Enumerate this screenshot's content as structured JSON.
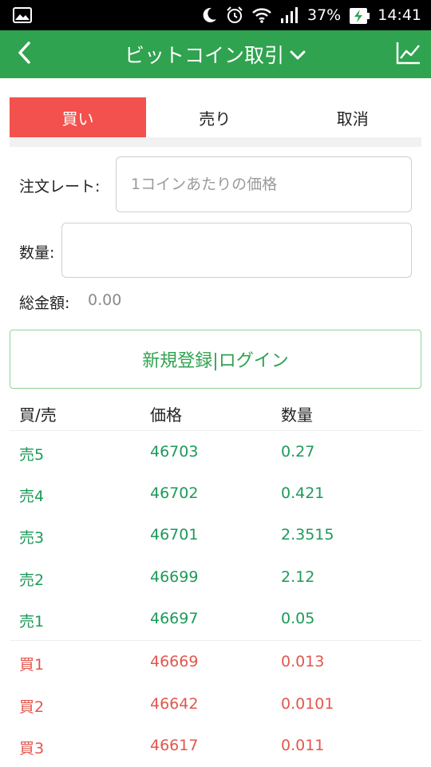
{
  "status_bar": {
    "battery": "37%",
    "time": "14:41",
    "icons": [
      "image-icon",
      "moon-icon",
      "alarm-icon",
      "wifi-icon",
      "signal-icon",
      "battery-charging-icon"
    ]
  },
  "app_bar": {
    "title": "ビットコイン取引",
    "back_icon": "chevron-left-icon",
    "dropdown_icon": "chevron-down-icon",
    "chart_icon": "line-chart-icon"
  },
  "tabs": [
    {
      "label": "買い",
      "active": true
    },
    {
      "label": "売り",
      "active": false
    },
    {
      "label": "取消",
      "active": false
    }
  ],
  "form": {
    "rate_label": "注文レート:",
    "rate_placeholder": "1コインあたりの価格",
    "qty_label": "数量:",
    "total_label": "総金額:",
    "total_value": "0.00"
  },
  "login_button": "新規登録|ログイン",
  "order_book": {
    "headers": [
      "買/売",
      "価格",
      "数量"
    ],
    "asks": [
      {
        "side": "売5",
        "price": "46703",
        "qty": "0.27"
      },
      {
        "side": "売4",
        "price": "46702",
        "qty": "0.421"
      },
      {
        "side": "売3",
        "price": "46701",
        "qty": "2.3515"
      },
      {
        "side": "売2",
        "price": "46699",
        "qty": "2.12"
      },
      {
        "side": "売1",
        "price": "46697",
        "qty": "0.05"
      }
    ],
    "bids": [
      {
        "side": "買1",
        "price": "46669",
        "qty": "0.013"
      },
      {
        "side": "買2",
        "price": "46642",
        "qty": "0.0101"
      },
      {
        "side": "買3",
        "price": "46617",
        "qty": "0.011"
      }
    ]
  },
  "colors": {
    "primary_green": "#2fa34f",
    "buy_red": "#f2514e",
    "ask_green": "#1d9a5a",
    "bid_red": "#e2574c"
  }
}
